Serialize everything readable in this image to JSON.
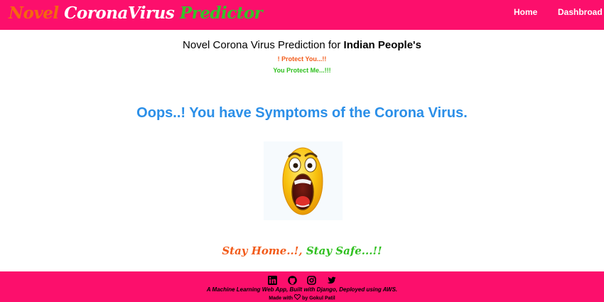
{
  "navbar": {
    "brand": {
      "part1": "Novel",
      "part2": "CoronaVirus",
      "part3": "Predictor"
    },
    "links": [
      {
        "label": "Home"
      },
      {
        "label": "Dashbroad"
      }
    ]
  },
  "main": {
    "heading_prefix": "Novel Corona Virus Prediction for",
    "heading_bold": "Indian People's",
    "line_red": "! Protect You...!!",
    "line_green": "You Protect Me...!!!",
    "result_text": "Oops..! You have Symptoms of the Corona Virus.",
    "emoji_icon": "shocked-face-emoji",
    "stay_home": "Stay Home..!",
    "stay_sep": ",",
    "stay_safe": "Stay Safe...!!"
  },
  "footer": {
    "social_icons": [
      "linkedin-icon",
      "github-icon",
      "instagram-icon",
      "twitter-icon"
    ],
    "tagline": "A Machine Learning Web App, Built with Django, Deployed using AWS.",
    "credit_prefix": "Made with",
    "credit_suffix": "by Gokul Patil"
  },
  "colors": {
    "brand_pink": "#fc0f6c",
    "orange_red": "#f25b1a",
    "green": "#30c020",
    "blue": "#2b8fe8"
  }
}
